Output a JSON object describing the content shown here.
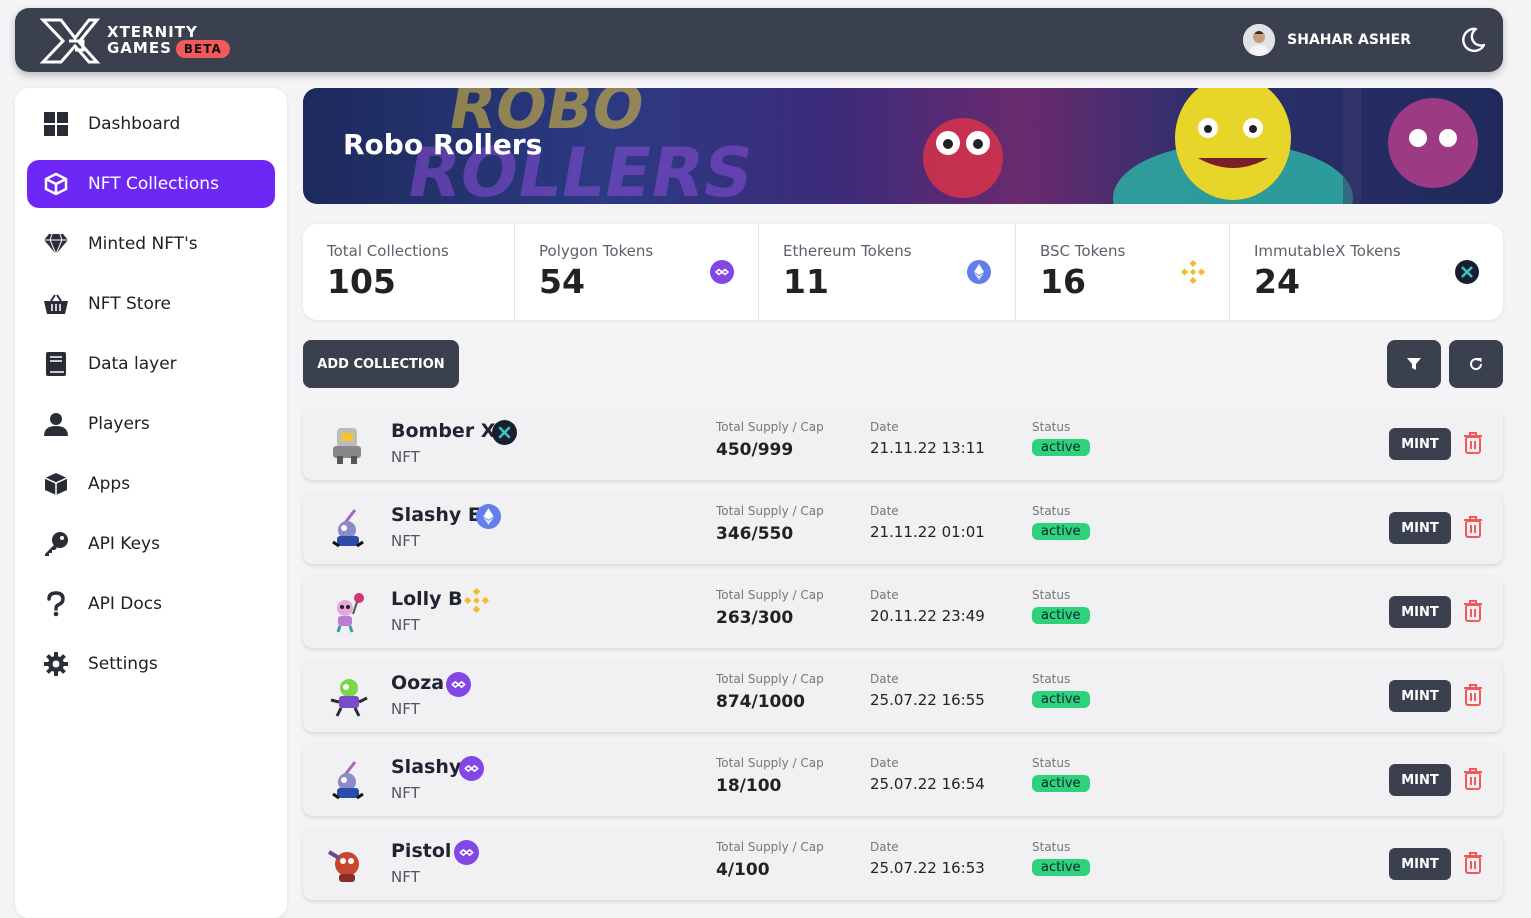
{
  "header": {
    "brand_line1": "XTERNITY",
    "brand_line2": "GAMES",
    "beta": "BETA",
    "user_name": "SHAHAR ASHER"
  },
  "sidebar": {
    "items": [
      {
        "label": "Dashboard",
        "icon": "dashboard-icon"
      },
      {
        "label": "NFT Collections",
        "icon": "cube-icon",
        "active": true
      },
      {
        "label": "Minted NFT's",
        "icon": "diamond-icon"
      },
      {
        "label": "NFT Store",
        "icon": "basket-icon"
      },
      {
        "label": "Data layer",
        "icon": "book-icon"
      },
      {
        "label": "Players",
        "icon": "user-icon"
      },
      {
        "label": "Apps",
        "icon": "box-icon"
      },
      {
        "label": "API Keys",
        "icon": "key-icon"
      },
      {
        "label": "API Docs",
        "icon": "question-icon"
      },
      {
        "label": "Settings",
        "icon": "gear-icon"
      }
    ]
  },
  "banner": {
    "title": "Robo Rollers"
  },
  "stats": [
    {
      "label": "Total Collections",
      "value": "105"
    },
    {
      "label": "Polygon Tokens",
      "value": "54",
      "icon": "polygon-icon"
    },
    {
      "label": "Ethereum Tokens",
      "value": "11",
      "icon": "ethereum-icon"
    },
    {
      "label": "BSC Tokens",
      "value": "16",
      "icon": "bsc-icon"
    },
    {
      "label": "ImmutableX Tokens",
      "value": "24",
      "icon": "immutablex-icon"
    }
  ],
  "actions": {
    "add_collection": "ADD COLLECTION"
  },
  "table": {
    "supply_label": "Total Supply / Cap",
    "date_label": "Date",
    "status_label": "Status",
    "mint_label": "MINT",
    "rows": [
      {
        "name": "Bomber X",
        "chain": "immutablex",
        "type": "NFT",
        "supply": "450/999",
        "date": "21.11.22 13:11",
        "status": "active"
      },
      {
        "name": "Slashy E",
        "chain": "ethereum",
        "type": "NFT",
        "supply": "346/550",
        "date": "21.11.22 01:01",
        "status": "active"
      },
      {
        "name": "Lolly B",
        "chain": "bsc",
        "type": "NFT",
        "supply": "263/300",
        "date": "20.11.22 23:49",
        "status": "active"
      },
      {
        "name": "Ooza",
        "chain": "polygon",
        "type": "NFT",
        "supply": "874/1000",
        "date": "25.07.22 16:55",
        "status": "active"
      },
      {
        "name": "Slashy",
        "chain": "polygon",
        "type": "NFT",
        "supply": "18/100",
        "date": "25.07.22 16:54",
        "status": "active"
      },
      {
        "name": "Pistol",
        "chain": "polygon",
        "type": "NFT",
        "supply": "4/100",
        "date": "25.07.22 16:53",
        "status": "active"
      }
    ]
  },
  "colors": {
    "accent": "#6d28f5",
    "dark": "#3b404e",
    "status_active": "#2dd27a",
    "trash": "#f05a5a"
  }
}
